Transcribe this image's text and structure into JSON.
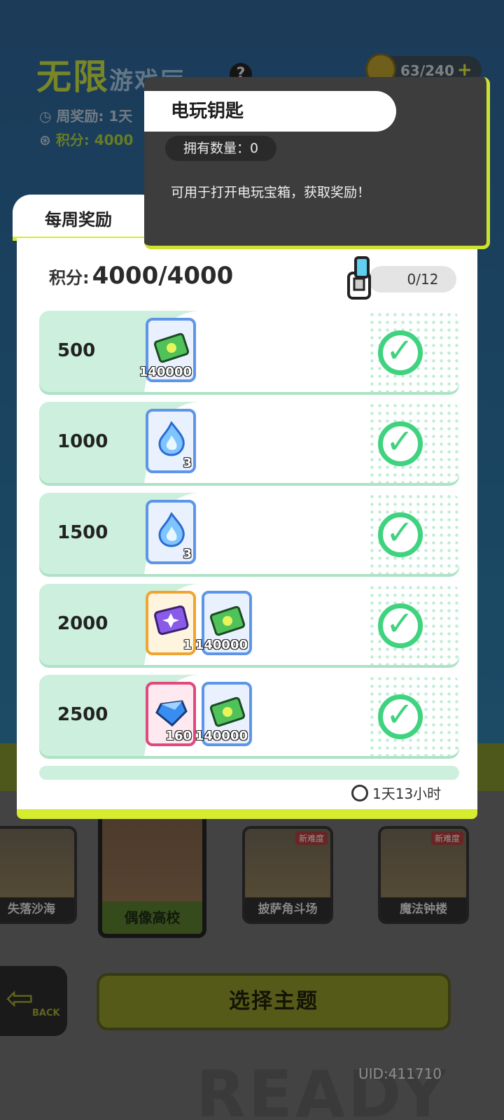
{
  "lobby": {
    "title_main": "无限",
    "title_sub": "游戏厅",
    "weekly_reward_label": "周奖励: 1天",
    "score_label": "积分: 4000",
    "key_counter": "63/240"
  },
  "panel": {
    "tab_label": "每周奖励",
    "score_label": "积分:",
    "score_value": "4000/4000",
    "key_progress": "0/12",
    "timer": "1天13小时",
    "tiers": [
      {
        "points": "500",
        "items": [
          {
            "icon": "cash-ticket-icon",
            "amount": "140000",
            "frame": "blue"
          }
        ]
      },
      {
        "points": "1000",
        "items": [
          {
            "icon": "blue-flame-icon",
            "amount": "3",
            "frame": "blue"
          }
        ]
      },
      {
        "points": "1500",
        "items": [
          {
            "icon": "blue-flame-icon",
            "amount": "3",
            "frame": "blue"
          }
        ]
      },
      {
        "points": "2000",
        "items": [
          {
            "icon": "purple-ticket-icon",
            "amount": "1",
            "frame": "orange"
          },
          {
            "icon": "cash-ticket-icon",
            "amount": "140000",
            "frame": "blue"
          }
        ]
      },
      {
        "points": "2500",
        "items": [
          {
            "icon": "diamond-icon",
            "amount": "160",
            "frame": "pink"
          },
          {
            "icon": "cash-ticket-icon",
            "amount": "140000",
            "frame": "blue"
          }
        ]
      }
    ]
  },
  "tooltip": {
    "title": "电玩钥匙",
    "owned": "拥有数量：0",
    "description": "可用于打开电玩宝箱，获取奖励！"
  },
  "maps": [
    {
      "label": "失落沙海",
      "tag": ""
    },
    {
      "label": "偶像高校",
      "tag": ""
    },
    {
      "label": "披萨角斗场",
      "tag": "新难度"
    },
    {
      "label": "魔法钟楼",
      "tag": "新难度"
    }
  ],
  "bottom": {
    "back_label": "BACK",
    "select_theme": "选择主题",
    "uid": "UID:411710",
    "bg_text": "READY"
  },
  "colors": {
    "accent_lime": "#d6ec2f",
    "check_green": "#3fd37f",
    "tier_bg": "#ccf0dd"
  }
}
